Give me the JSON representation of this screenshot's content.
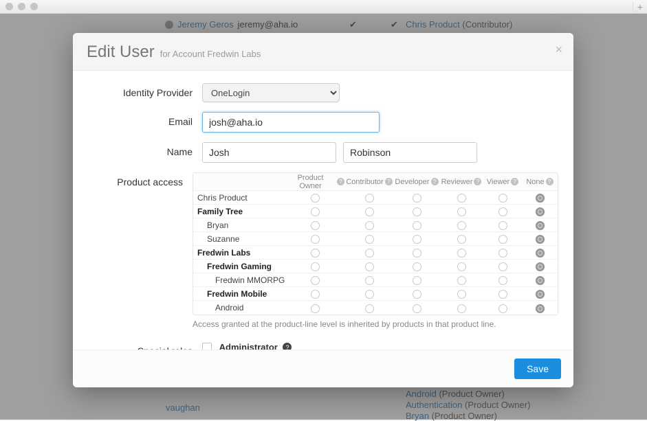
{
  "bg": {
    "user_name": "Jeremy Geros",
    "user_email": "jeremy@aha.io",
    "right_user": "Chris Product",
    "right_role": "(Contributor)",
    "vaughan": "vaughan",
    "bottom": [
      {
        "name": "Android",
        "role": "(Product Owner)"
      },
      {
        "name": "Authentication",
        "role": "(Product Owner)"
      },
      {
        "name": "Bryan",
        "role": "(Product Owner)"
      }
    ]
  },
  "modal": {
    "title": "Edit User",
    "subtitle": "for Account Fredwin Labs",
    "labels": {
      "identity": "Identity Provider",
      "email": "Email",
      "name": "Name",
      "product_access": "Product access",
      "special_roles": "Special roles"
    },
    "fields": {
      "identity_value": "OneLogin",
      "email_value": "josh@aha.io",
      "first_name": "Josh",
      "last_name": "Robinson",
      "admin_label": "Administrator"
    },
    "columns": [
      "Product Owner",
      "Contributor",
      "Developer",
      "Reviewer",
      "Viewer",
      "None"
    ],
    "rows": [
      {
        "name": "Chris Product",
        "bold": false,
        "indent": 0,
        "selected": "none"
      },
      {
        "name": "Family Tree",
        "bold": true,
        "indent": 0,
        "selected": "none"
      },
      {
        "name": "Bryan",
        "bold": false,
        "indent": 1,
        "selected": "none"
      },
      {
        "name": "Suzanne",
        "bold": false,
        "indent": 1,
        "selected": "none"
      },
      {
        "name": "Fredwin Labs",
        "bold": true,
        "indent": 0,
        "selected": "none"
      },
      {
        "name": "Fredwin Gaming",
        "bold": true,
        "indent": 1,
        "selected": "none"
      },
      {
        "name": "Fredwin MMORPG",
        "bold": false,
        "indent": 2,
        "selected": "none"
      },
      {
        "name": "Fredwin Mobile",
        "bold": true,
        "indent": 1,
        "selected": "none"
      },
      {
        "name": "Android",
        "bold": false,
        "indent": 2,
        "selected": "none"
      }
    ],
    "note": "Access granted at the product-line level is inherited by products in that product line.",
    "save": "Save"
  }
}
